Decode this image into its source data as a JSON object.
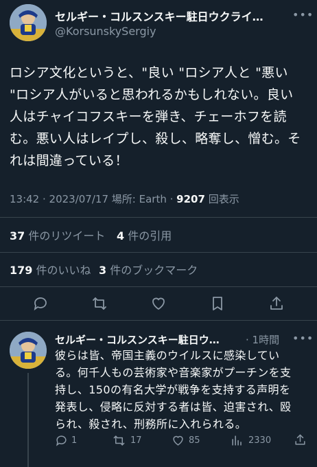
{
  "main_tweet": {
    "author_name": "セルギー・コルスンスキー駐日ウクライ…",
    "author_handle": "@KorsunskySergiy",
    "lines": [
      "ロシア文化というと、\"良い \"ロシア人と \"悪い",
      "\"ロシア人がいると思われるかもしれない。良い",
      "人はチャイコフスキーを弾き、チェーホフを読",
      "む。悪い人はレイプし、殺し、略奪し、憎む。そ",
      "れは間違っている！"
    ],
    "meta": {
      "datetime": "13:42 · 2023/07/17",
      "place_label": "場所: Earth ·",
      "views_count": "9207",
      "views_label": "回表示"
    },
    "stats": {
      "retweets_count": "37",
      "retweets_label": "件のリツイート",
      "quotes_count": "4",
      "quotes_label": "件の引用",
      "likes_count": "179",
      "likes_label": "件のいいね",
      "bookmarks_count": "3",
      "bookmarks_label": "件のブックマーク"
    }
  },
  "reply_tweet": {
    "author_name": "セルギー・コルスンスキー駐日ウ…",
    "time": "· 1時間",
    "lines": [
      "彼らは皆、帝国主義のウイルスに感染してい",
      "る。何千人もの芸術家や音楽家がプーチンを支",
      "持し、150の有名大学が戦争を支持する声明を",
      "発表し、侵略に反対する者は皆、迫害され、殴",
      "られ、殺され、刑務所に入れられる。"
    ],
    "counts": {
      "replies": "1",
      "retweets": "17",
      "likes": "85",
      "views": "2330"
    }
  },
  "theme": {
    "background": "#15202b",
    "text": "#f7f9f9",
    "secondary": "#8b98a5",
    "divider": "#38444d"
  }
}
